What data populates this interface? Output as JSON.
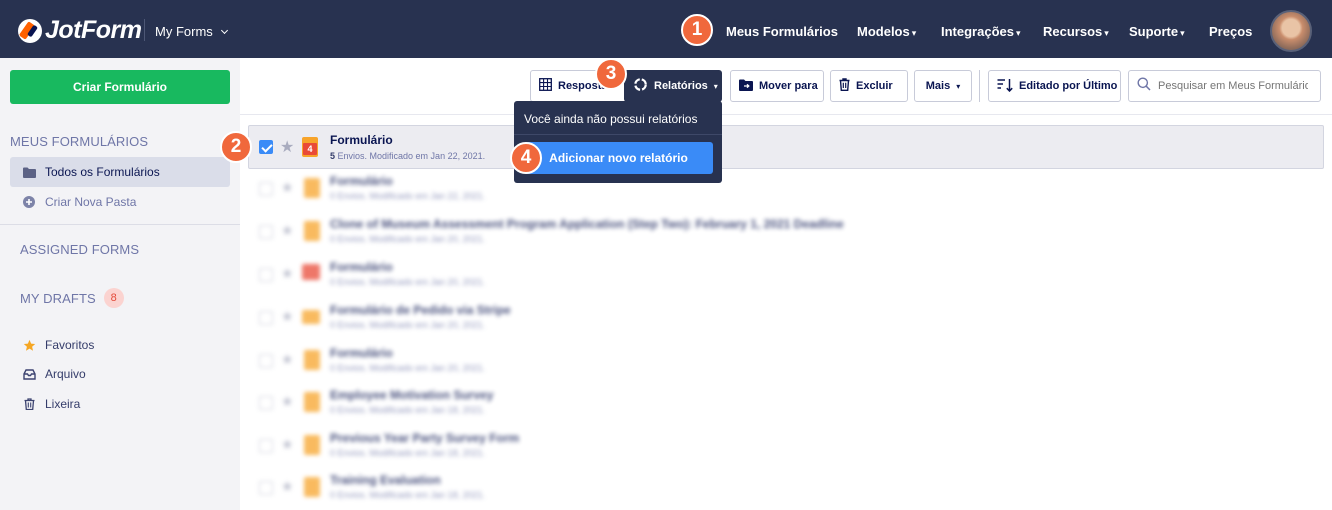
{
  "header": {
    "logo_text": "JotForm",
    "workspace_label": "My Forms",
    "nav": [
      {
        "label": "Meus Formulários",
        "caret": ""
      },
      {
        "label": "Modelos",
        "caret": "▾"
      },
      {
        "label": "Integrações",
        "caret": "▾"
      },
      {
        "label": "Recursos",
        "caret": "▾"
      },
      {
        "label": "Suporte",
        "caret": "▾"
      },
      {
        "label": "Preços",
        "caret": ""
      }
    ]
  },
  "steps": [
    "1",
    "2",
    "3",
    "4"
  ],
  "sidebar": {
    "create_button": "Criar Formulário",
    "section_my_forms": "MEUS FORMULÁRIOS",
    "all_forms": "Todos os Formulários",
    "new_folder": "Criar Nova Pasta",
    "assigned_forms": "ASSIGNED FORMS",
    "my_drafts": "MY DRAFTS",
    "drafts_count": "8",
    "favorites": "Favoritos",
    "archive": "Arquivo",
    "trash": "Lixeira"
  },
  "toolbar": {
    "responses": "Respostas",
    "reports": "Relatórios",
    "move_to": "Mover para",
    "delete": "Excluir",
    "more": "Mais",
    "sort": "Editado por Último",
    "search_placeholder": "Pesquisar em Meus Formulários"
  },
  "reports_dropdown": {
    "empty_message": "Você ainda não possui relatórios",
    "add_button": "Adicionar novo relatório"
  },
  "forms": [
    {
      "title": "Formulário",
      "count": "5",
      "meta_rest": " Envios. Modificado em Jan 22, 2021.",
      "selected": true,
      "icon": "orange",
      "badge": "4"
    },
    {
      "title": "Formulário",
      "meta": "0 Envios. Modificado em Jan 22, 2021.",
      "icon": "orange"
    },
    {
      "title": "Clone of Museum Assessment Program Application (Step Two): February 1, 2021 Deadline",
      "meta": "0 Envios. Modificado em Jan 20, 2021.",
      "icon": "orange"
    },
    {
      "title": "Formulário",
      "meta": "0 Envios. Modificado em Jan 20, 2021.",
      "icon": "red"
    },
    {
      "title": "Formulário de Pedido via Stripe",
      "meta": "0 Envios. Modificado em Jan 20, 2021.",
      "icon": "orange"
    },
    {
      "title": "Formulário",
      "meta": "0 Envios. Modificado em Jan 20, 2021.",
      "icon": "orange"
    },
    {
      "title": "Employee Motivation Survey",
      "meta": "0 Envios. Modificado em Jan 18, 2021.",
      "icon": "orange"
    },
    {
      "title": "Previous Year Party Survey Form",
      "meta": "0 Envios. Modificado em Jan 18, 2021.",
      "icon": "orange"
    },
    {
      "title": "Training Evaluation",
      "meta": "0 Envios. Modificado em Jan 18, 2021.",
      "icon": "orange"
    }
  ]
}
